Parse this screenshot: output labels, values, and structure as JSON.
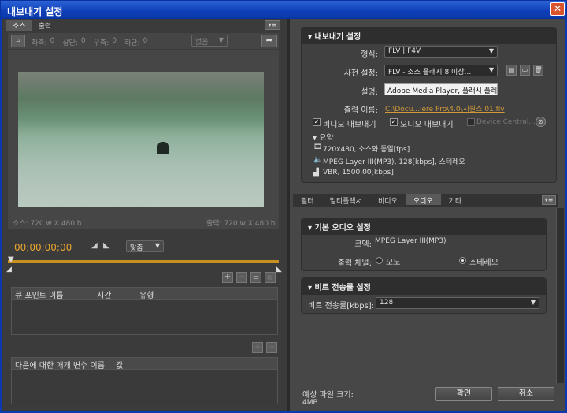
{
  "window": {
    "title": "내보내기 설정",
    "close_glyph": "✕"
  },
  "left": {
    "tabs": [
      {
        "label": "소스"
      },
      {
        "label": "출력"
      }
    ],
    "crop": {
      "left_label": "좌측:",
      "left_value": "0",
      "top_label": "상단:",
      "top_value": "0",
      "right_label": "우측:",
      "right_value": "0",
      "bottom_label": "하단:",
      "bottom_value": "0",
      "ratio_select": "없음"
    },
    "source_info": "소스: 720 w X 480 h",
    "output_info": "출력: 720 w X 480 h",
    "timecode": "00;00;00;00",
    "fit_select": "맞춤",
    "cue_table": {
      "headers": [
        "큐 포인트 이름",
        "시간",
        "유형"
      ]
    },
    "param_table": {
      "headers": [
        "다음에 대한 매개 변수 이름",
        "값"
      ]
    }
  },
  "export": {
    "header": "내보내기 설정",
    "format_label": "형식:",
    "format_value": "FLV | F4V",
    "preset_label": "사전 설정:",
    "preset_value": "FLV - 소스 플래시 8 이상...",
    "desc_label": "설명:",
    "desc_value": "Adobe Media Player, 플래시 플레이",
    "output_label": "출력 이름:",
    "output_value": "C:\\Docu...iere Pro\\4.0\\시퀀스 01.flv",
    "video_check": "비디오 내보내기",
    "audio_check": "오디오 내보내기",
    "device_central": "Device Central...",
    "summary_label": "요약",
    "summary": [
      "720x480, 소스와 동일[fps]",
      "MPEG Layer III(MP3), 128[kbps], 스테레오",
      "VBR, 1500.00[kbps]"
    ]
  },
  "right_tabs": [
    {
      "label": "필터"
    },
    {
      "label": "멀티플렉서"
    },
    {
      "label": "비디오"
    },
    {
      "label": "오디오"
    },
    {
      "label": "기타"
    }
  ],
  "audio": {
    "basic_header": "기본 오디오 설정",
    "codec_label": "코덱:",
    "codec_value": "MPEG Layer III(MP3)",
    "channel_label": "출력 채널:",
    "mono": "모노",
    "stereo": "스테레오",
    "bitrate_header": "비트 전송률 설정",
    "bitrate_label": "비트 전송률[kbps]:",
    "bitrate_value": "128"
  },
  "footer": {
    "size_label": "예상 파일 크기:",
    "size_value": "4MB",
    "ok": "확인",
    "cancel": "취소"
  },
  "colors": {
    "accent": "#e8a430",
    "titlebar": "#0f3fb8"
  }
}
